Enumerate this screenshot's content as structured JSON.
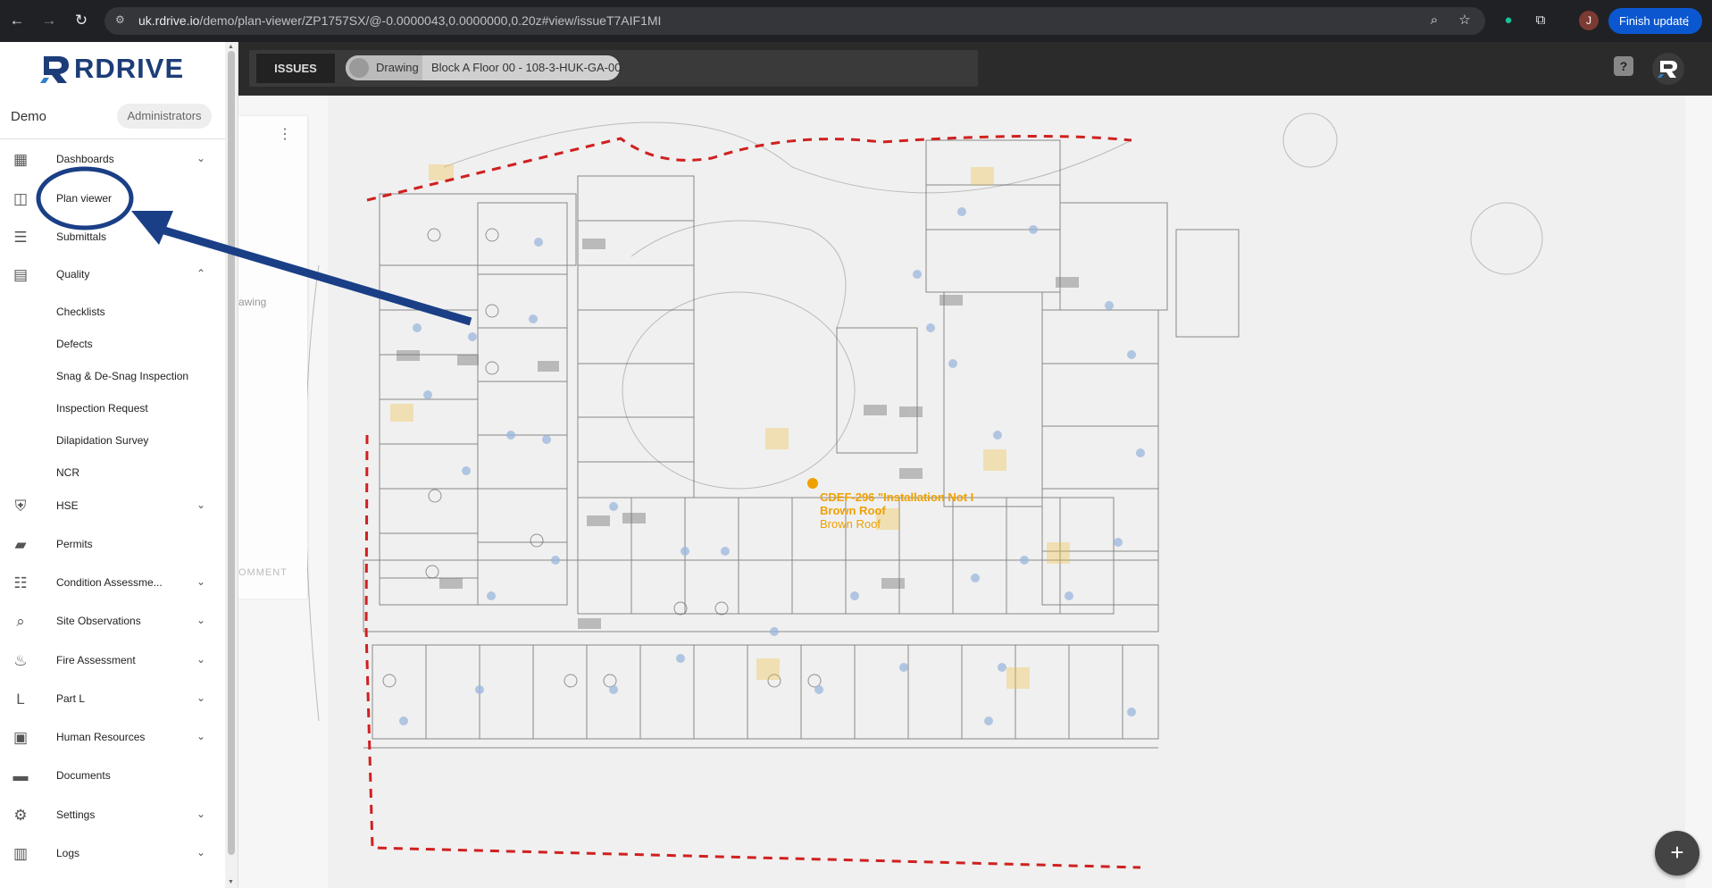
{
  "browser": {
    "url_host": "uk.rdrive.io",
    "url_path": "/demo/plan-viewer/ZP1757SX/@-0.0000043,0.0000000,0.20z#view/issueT7AIF1MI",
    "profile_initial": "J",
    "finish_update_label": "Finish update"
  },
  "brand": {
    "logo_text": "RDRIVE",
    "accent": "#1d3d78"
  },
  "sidebar": {
    "workspace": "Demo",
    "role": "Administrators",
    "items": [
      {
        "label": "Dashboards",
        "icon": "dashboard-icon"
      },
      {
        "label": "Plan viewer",
        "icon": "map-icon"
      },
      {
        "label": "Submittals",
        "icon": "document-icon"
      },
      {
        "label": "Quality",
        "icon": "clipboard-icon"
      },
      {
        "label": "HSE",
        "icon": "shield-icon"
      },
      {
        "label": "Permits",
        "icon": "folder-clock-icon"
      },
      {
        "label": "Condition Assessme...",
        "icon": "checklist-icon"
      },
      {
        "label": "Site Observations",
        "icon": "search-zoom-icon"
      },
      {
        "label": "Fire Assessment",
        "icon": "fire-icon"
      },
      {
        "label": "Part L",
        "icon": "part-l-icon"
      },
      {
        "label": "Human Resources",
        "icon": "id-card-icon"
      },
      {
        "label": "Documents",
        "icon": "folder-icon"
      },
      {
        "label": "Settings",
        "icon": "gear-icon"
      },
      {
        "label": "Logs",
        "icon": "log-book-icon"
      }
    ],
    "quality_sub": [
      "Checklists",
      "Defects",
      "Snag & De-Snag Inspection",
      "Inspection Request",
      "Dilapidation Survey",
      "NCR"
    ]
  },
  "header": {
    "tab_issues": "ISSUES",
    "drawing_prefix": "Drawing",
    "drawing_name": "Block A Floor 00 - 108-3-HUK-GA-00"
  },
  "panel": {
    "partial_drawing": "awing",
    "partial_comment": "OMMENT"
  },
  "marker": {
    "title": "CDEF-296 \"Installation Not I",
    "line2": "Brown Roof",
    "line3": "Brown Roof",
    "color": "#f0a000"
  },
  "fab_label": "+"
}
